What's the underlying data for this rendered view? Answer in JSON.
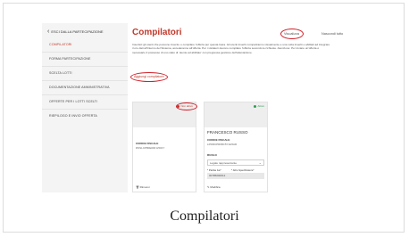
{
  "sidebar": {
    "back_label": "ESCI DALLA PARTECIPAZIONE",
    "items": [
      {
        "label": "COMPILATORI",
        "active": true
      },
      {
        "label": "FORMA PARTECIPAZIONE",
        "active": false
      },
      {
        "label": "SCELTA LOTTI",
        "active": false
      },
      {
        "label": "DOCUMENTAZIONE AMMINISTRATIVA",
        "active": false
      },
      {
        "label": "OFFERTE PER I LOTTI SCELTI",
        "active": false
      },
      {
        "label": "RIEPILOGO E INVIO OFFERTA",
        "active": false
      }
    ]
  },
  "main": {
    "title": "Compilatori",
    "nav_visualizza": "Visualizza",
    "nav_nascondi": "Nascondi tutto",
    "description": "Inserisci gli utenti che possono inserire o compilare l'offerta per questa Gara. Gli utenti inseriti compariranno visualmente e una volta inseriti e abilitati ad integrare i loro dati all'interno del Sistema, accederanno all'offerta. Per i visitatori devono compilare l'offerta secondo le richieste. Atenzione: Per inviare un'offerta è necessario il possesso di uno stato di 'utente ad abilitato' con pregressa gestione dell'attestazione.",
    "add_button": "Aggiungi compilatore"
  },
  "cards": [
    {
      "badge": "Non attivo",
      "badge_color": "#c0392b",
      "name": "",
      "codice_label": "CODICE FISCALE",
      "codice_value": "RSSLCP80E000 H501Y",
      "action": "Rimuovi"
    },
    {
      "badge": "Attivo",
      "badge_color": "#2e9e4f",
      "name": "FRANCESCO RUSSO",
      "codice_label": "CODICE FISCALE",
      "codice_value": "LPRRCPR68C5Y1H5AR",
      "ruolo_label": "RUOLO",
      "ruolo_value": "Legale rappresentante",
      "partita_label": "* Partita Iva*",
      "altro_label": "* Altro Specificatore*",
      "partita_value": "00785090012",
      "action": "Modifica"
    }
  ],
  "caption": "Compilatori"
}
